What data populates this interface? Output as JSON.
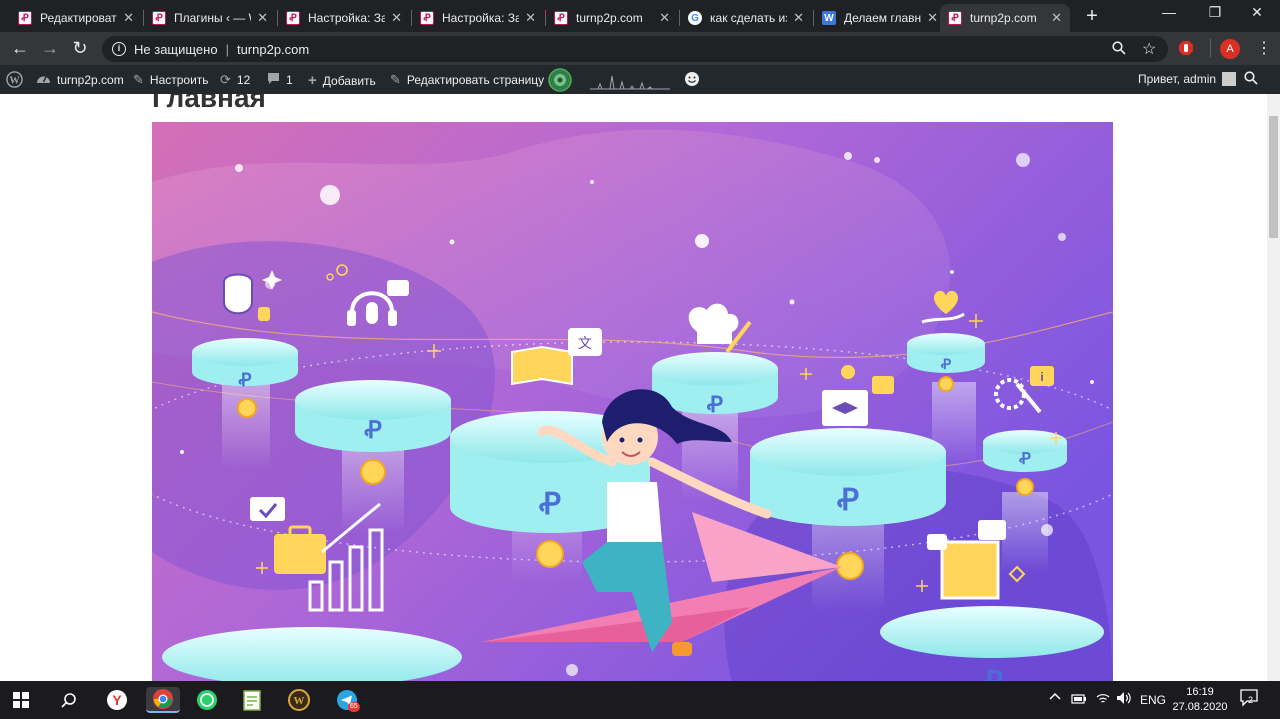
{
  "tabs": [
    {
      "title": "Редактировать",
      "favicon": "p2p"
    },
    {
      "title": "Плагины ‹ — W",
      "favicon": "p2p"
    },
    {
      "title": "Настройка: За",
      "favicon": "p2p"
    },
    {
      "title": "Настройка: За",
      "favicon": "p2p"
    },
    {
      "title": "turnp2p.com",
      "favicon": "p2p"
    },
    {
      "title": "как сделать из",
      "favicon": "google"
    },
    {
      "title": "Делаем главн",
      "favicon": "wordpress"
    },
    {
      "title": "turnp2p.com",
      "favicon": "p2p",
      "active": true
    }
  ],
  "address": {
    "security_label": "Не защищено",
    "url": "turnp2p.com"
  },
  "profile_initial": "A",
  "admin_bar": {
    "site_name": "turnp2p.com",
    "customize": "Настроить",
    "updates_count": "12",
    "comments_count": "1",
    "add_new": "Добавить",
    "edit_page": "Редактировать страницу",
    "greeting": "Привет, admin"
  },
  "page": {
    "title": "Главная"
  },
  "taskbar": {
    "language": "ENG",
    "time": "16:19",
    "date": "27.08.2020",
    "notifications": "2",
    "telegram_badge": "65"
  },
  "colors": {
    "chrome_dark": "#202124",
    "chrome_toolbar": "#35363a",
    "wp_admin_bar": "#23282d",
    "hero_purple": "#8a4fd8",
    "hero_pink": "#d56fb6",
    "platform_teal": "#a8f0ef"
  }
}
